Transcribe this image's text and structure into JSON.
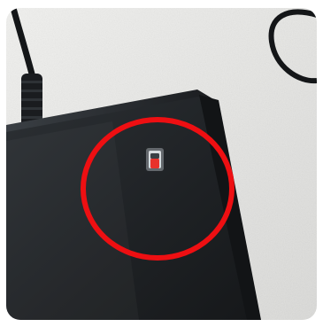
{
  "image": {
    "subject": "black-device-indicator-light",
    "background_color": "#e9e9e7",
    "device_color": "#262a2e",
    "indicator_color": "#e8322b",
    "highlight_circle_color": "#ee0f12",
    "cable_color": "#141618"
  }
}
